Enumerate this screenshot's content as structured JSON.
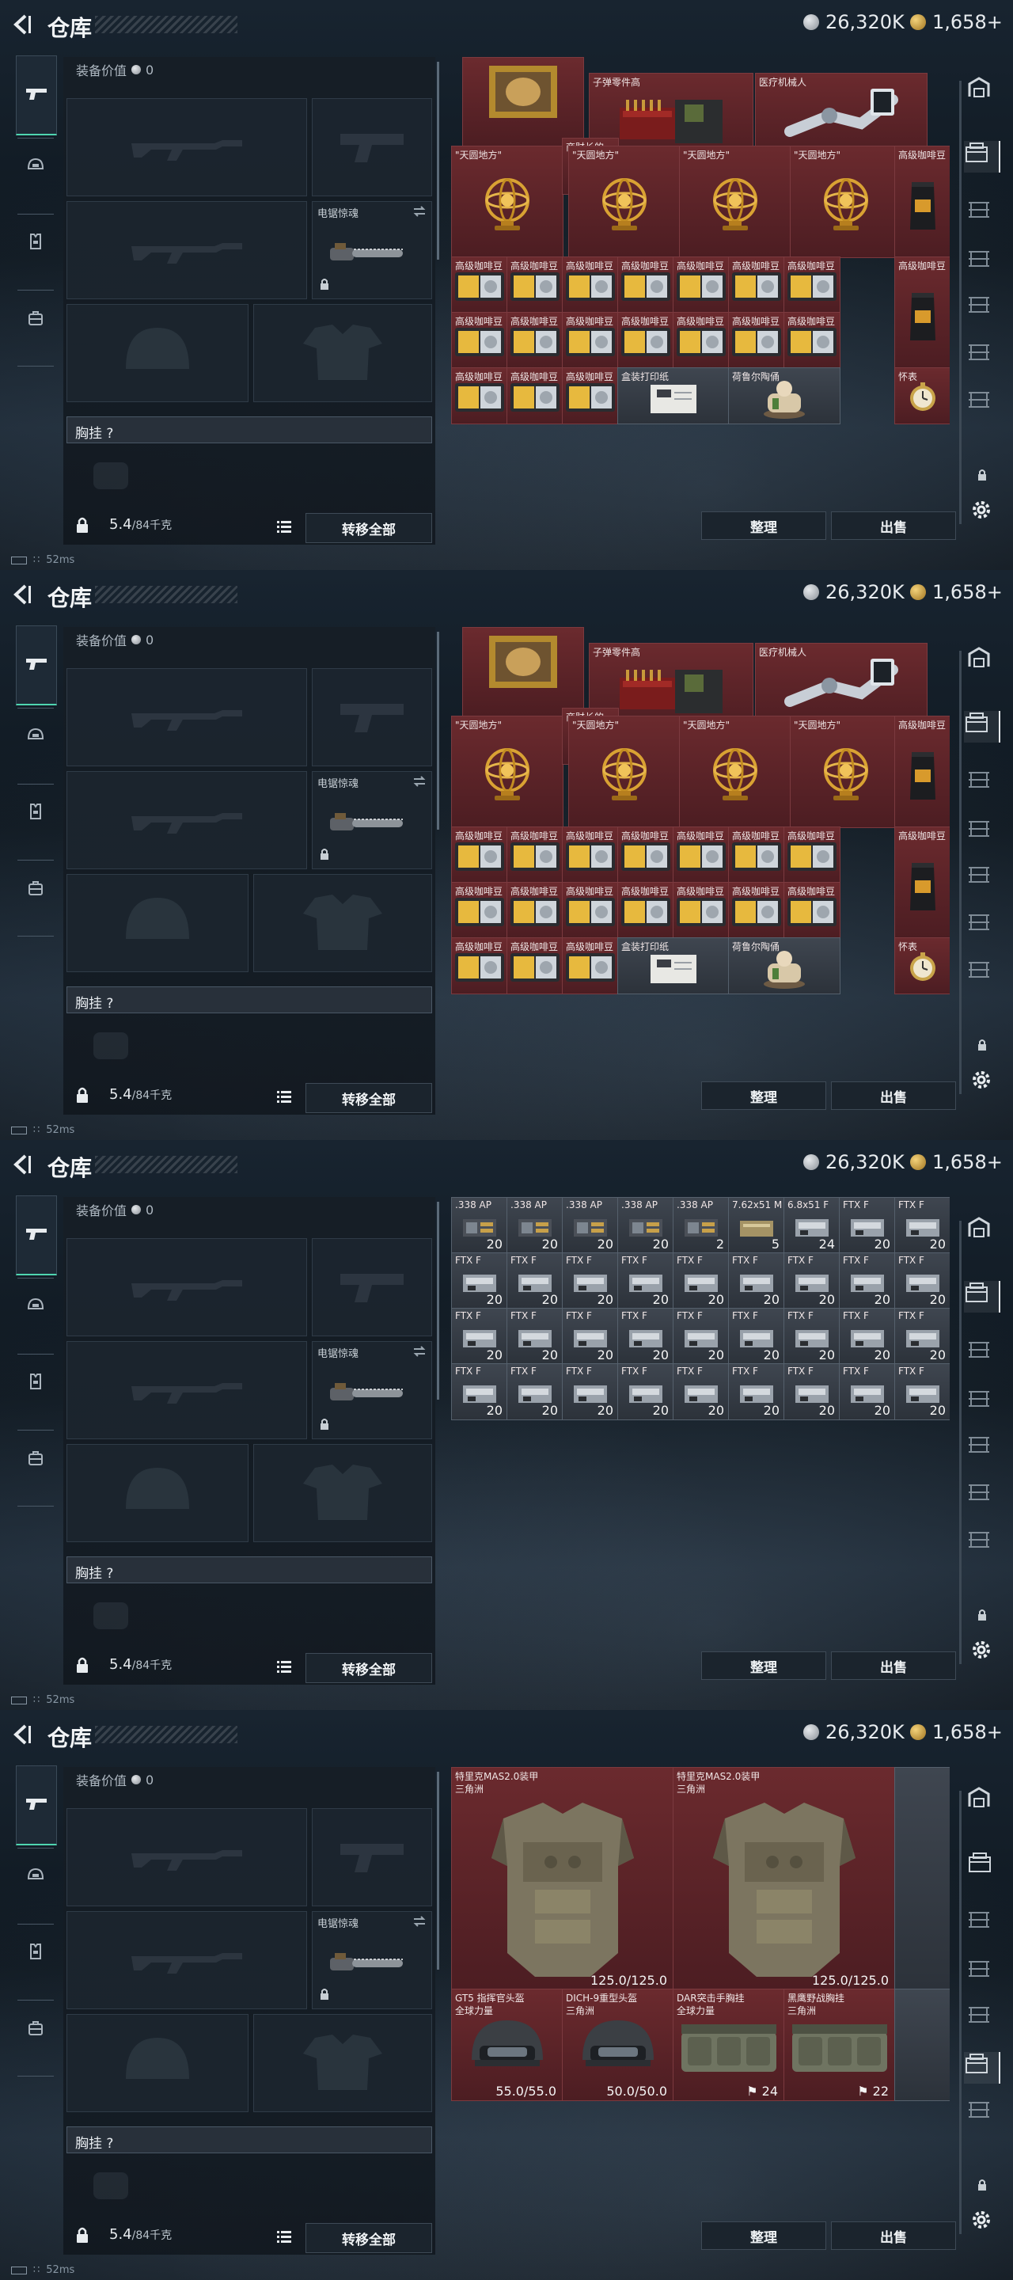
{
  "header": {
    "title": "仓库",
    "silver": "26,320K",
    "gold": "1,658+"
  },
  "status": {
    "ping": "52ms"
  },
  "loadout": {
    "equip_value_label": "装备价值",
    "equip_value": "0",
    "sidearm_slot_label": "电锯惊魂",
    "chest_label": "胸挂  ?",
    "weight": "5.4",
    "weight_max": "/84千克",
    "transfer_all": "转移全部"
  },
  "actions": {
    "sort": "整理",
    "sell": "出售"
  },
  "screens": [
    {
      "id": "valuables-1",
      "items": [
        {
          "name": "",
          "kind": "painting"
        },
        {
          "name": "子弹零件高",
          "kind": "parts"
        },
        {
          "name": "医疗机械人",
          "kind": "robot"
        },
        {
          "name": "\"天圆地方\"",
          "kind": "globe"
        },
        {
          "name": "商财长的",
          "kind": "medal"
        },
        {
          "name": "\"天圆地方\"",
          "kind": "globe"
        },
        {
          "name": "\"天圆地方\"",
          "kind": "globe"
        },
        {
          "name": "\"天圆地方\"",
          "kind": "globe"
        },
        {
          "name": "高级咖啡豆",
          "kind": "coffee"
        },
        {
          "name": "高级咖啡豆",
          "kind": "tin"
        },
        {
          "name": "高级咖啡豆",
          "kind": "tin"
        },
        {
          "name": "高级咖啡豆",
          "kind": "tin"
        },
        {
          "name": "高级咖啡豆",
          "kind": "tin"
        },
        {
          "name": "高级咖啡豆",
          "kind": "tin"
        },
        {
          "name": "高级咖啡豆",
          "kind": "coffee"
        },
        {
          "name": "高级咖啡豆",
          "kind": "tin"
        },
        {
          "name": "高级咖啡豆",
          "kind": "tin"
        },
        {
          "name": "高级咖啡豆",
          "kind": "tin"
        },
        {
          "name": "高级咖啡豆",
          "kind": "tin"
        },
        {
          "name": "高级咖啡豆",
          "kind": "tin"
        },
        {
          "name": "高级咖啡豆",
          "kind": "coffee"
        },
        {
          "name": "高级咖啡豆",
          "kind": "tin"
        },
        {
          "name": "高级咖啡豆",
          "kind": "tin"
        },
        {
          "name": "盒装打印纸",
          "kind": "paper"
        },
        {
          "name": "荷鲁尔陶俑",
          "kind": "figurine"
        },
        {
          "name": "怀表",
          "kind": "watch"
        }
      ]
    },
    {
      "id": "valuables-2",
      "items": [
        {
          "name": "",
          "kind": "painting"
        },
        {
          "name": "子弹零件高",
          "kind": "parts"
        },
        {
          "name": "医疗机械人",
          "kind": "robot"
        },
        {
          "name": "\"天圆地方\"",
          "kind": "globe"
        },
        {
          "name": "商财长的",
          "kind": "medal"
        },
        {
          "name": "\"天圆地方\"",
          "kind": "globe"
        },
        {
          "name": "\"天圆地方\"",
          "kind": "globe"
        },
        {
          "name": "\"天圆地方\"",
          "kind": "globe"
        },
        {
          "name": "高级咖啡豆",
          "kind": "coffee"
        },
        {
          "name": "高级咖啡豆",
          "kind": "tin"
        },
        {
          "name": "高级咖啡豆",
          "kind": "tin"
        },
        {
          "name": "高级咖啡豆",
          "kind": "tin"
        },
        {
          "name": "高级咖啡豆",
          "kind": "tin"
        },
        {
          "name": "高级咖啡豆",
          "kind": "tin"
        },
        {
          "name": "高级咖啡豆",
          "kind": "coffee"
        },
        {
          "name": "高级咖啡豆",
          "kind": "tin"
        },
        {
          "name": "高级咖啡豆",
          "kind": "tin"
        },
        {
          "name": "高级咖啡豆",
          "kind": "tin"
        },
        {
          "name": "高级咖啡豆",
          "kind": "tin"
        },
        {
          "name": "高级咖啡豆",
          "kind": "tin"
        },
        {
          "name": "高级咖啡豆",
          "kind": "coffee"
        },
        {
          "name": "高级咖啡豆",
          "kind": "tin"
        },
        {
          "name": "高级咖啡豆",
          "kind": "tin"
        },
        {
          "name": "盒装打印纸",
          "kind": "paper"
        },
        {
          "name": "荷鲁尔陶俑",
          "kind": "figurine"
        },
        {
          "name": "怀表",
          "kind": "watch"
        }
      ]
    },
    {
      "id": "ammo",
      "items": [
        {
          "name": ".338 AP",
          "count": "20"
        },
        {
          "name": ".338 AP",
          "count": "20"
        },
        {
          "name": ".338 AP",
          "count": "20"
        },
        {
          "name": ".338 AP",
          "count": "20"
        },
        {
          "name": ".338 AP",
          "count": "2"
        },
        {
          "name": "7.62x51 M",
          "count": "5"
        },
        {
          "name": "6.8x51 F",
          "count": "24"
        },
        {
          "name": "FTX F",
          "count": "20"
        },
        {
          "name": "FTX F",
          "count": "20"
        }
      ],
      "ftx_rows": 3,
      "ftx_label": "FTX F",
      "ftx_count": "20"
    },
    {
      "id": "armor",
      "items": [
        {
          "name": "特里克MAS2.0装甲",
          "sub": "三角洲",
          "durability": "125.0/125.0"
        },
        {
          "name": "特里克MAS2.0装甲",
          "sub": "三角洲",
          "durability": "125.0/125.0"
        },
        {
          "name": "GT5 指挥官头盔",
          "sub": "全球力量",
          "durability": "55.0/55.0"
        },
        {
          "name": "DICH-9重型头盔",
          "sub": "三角洲",
          "durability": "50.0/50.0"
        },
        {
          "name": "DAR突击手胸挂",
          "sub": "全球力量",
          "slots": "24"
        },
        {
          "name": "黑鹰野战胸挂",
          "sub": "三角洲",
          "slots": "22"
        }
      ]
    }
  ]
}
